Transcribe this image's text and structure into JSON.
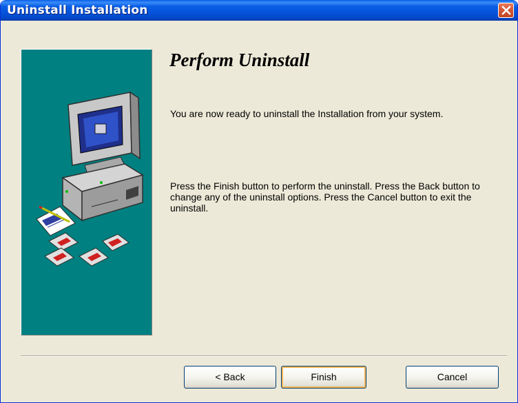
{
  "window": {
    "title": "Uninstall  Installation"
  },
  "page": {
    "heading": "Perform Uninstall",
    "ready_text": "You are now ready to uninstall the  Installation from your system.",
    "instructions_text": "Press the Finish button to perform the uninstall. Press the Back button to change any of the uninstall options. Press the Cancel button to exit the uninstall."
  },
  "buttons": {
    "back": "< Back",
    "finish": "Finish",
    "cancel": "Cancel"
  },
  "icons": {
    "close": "close-icon",
    "illustration": "computer-floppy-disks-illustration"
  },
  "colors": {
    "title_bar": "#0553dc",
    "dialog_bg": "#ece9d8",
    "panel_bg": "#008080",
    "close_button": "#d65b3a"
  }
}
